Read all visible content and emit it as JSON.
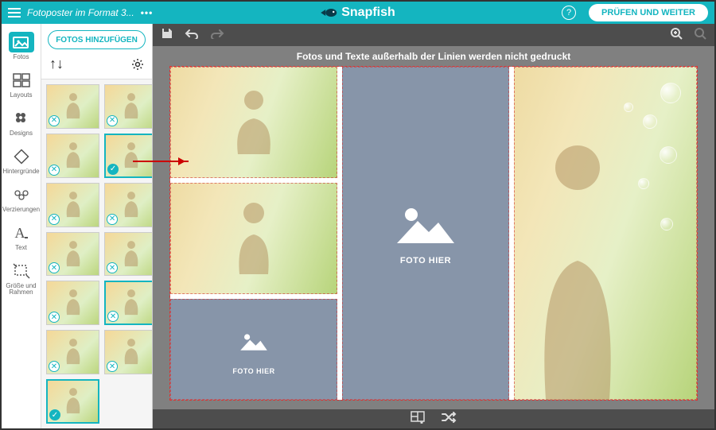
{
  "header": {
    "doc_title": "Fotoposter im Format 3...",
    "brand": "Snapfish",
    "proceed_label": "PRÜFEN UND WEITER",
    "help_symbol": "?"
  },
  "leftrail": [
    {
      "id": "photos",
      "label": "Fotos",
      "icon": "image-stack-icon",
      "active": true
    },
    {
      "id": "layouts",
      "label": "Layouts",
      "icon": "layout-grid-icon"
    },
    {
      "id": "designs",
      "label": "Designs",
      "icon": "flower-icon"
    },
    {
      "id": "backgrounds",
      "label": "Hintergründe",
      "icon": "diamond-icon"
    },
    {
      "id": "embellish",
      "label": "Verzierungen",
      "icon": "ornament-icon"
    },
    {
      "id": "text",
      "label": "Text",
      "icon": "text-icon"
    },
    {
      "id": "size",
      "label": "Größe und Rahmen",
      "icon": "crop-icon"
    }
  ],
  "panel": {
    "add_label": "FOTOS HINZUFÜGEN",
    "sort_symbol": "↑↓",
    "thumbs": [
      {
        "badge": "x"
      },
      {
        "badge": "x"
      },
      {
        "badge": "x"
      },
      {
        "badge": "check",
        "selected": true
      },
      {
        "badge": "x"
      },
      {
        "badge": "x"
      },
      {
        "badge": "x"
      },
      {
        "badge": "x"
      },
      {
        "badge": "x"
      },
      {
        "badge": "x",
        "selected": true
      },
      {
        "badge": "x"
      },
      {
        "badge": "x"
      },
      {
        "badge": "check",
        "selected": true
      }
    ]
  },
  "canvas": {
    "hint": "Fotos und Texte außerhalb der Linien werden nicht gedruckt",
    "placeholder_label": "FOTO HIER"
  },
  "toolbar": {
    "save": "save-icon",
    "undo": "undo-icon",
    "redo": "redo-icon",
    "zoom_in": "zoom-in-icon",
    "zoom_fit": "zoom-fit-icon"
  },
  "bottombar": {
    "layout": "layout-icon",
    "shuffle": "shuffle-icon"
  }
}
